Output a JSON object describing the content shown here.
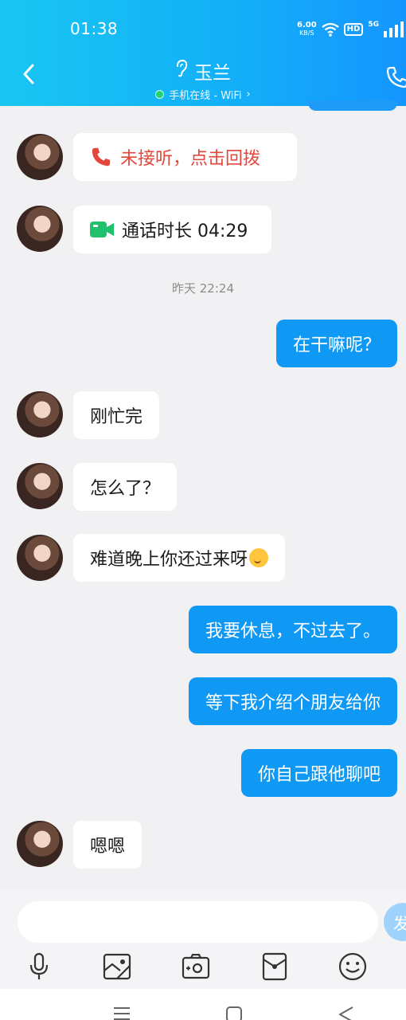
{
  "status_bar": {
    "time": "01:38",
    "speed_value": "6.00",
    "speed_unit": "KB/S",
    "hd": "HD",
    "network": "5G"
  },
  "header": {
    "title": "玉兰",
    "subtitle": "手机在线 - WiFi",
    "subtitle_arrow": "›"
  },
  "messages": {
    "missed_call": "未接听，点击回拨",
    "video_call": "通话时长 04:29",
    "timestamp": "昨天 22:24",
    "m1": "在干嘛呢？",
    "m2": "刚忙完",
    "m3": "怎么了？",
    "m4": "难道晚上你还过来呀",
    "m5": "我要休息，不过去了。",
    "m6": "等下我介绍个朋友给你",
    "m7": "你自己跟他聊吧",
    "m8": "嗯嗯"
  },
  "input": {
    "placeholder": "",
    "send_label": "发"
  },
  "colors": {
    "header_start": "#19c6f2",
    "header_end": "#1596ff",
    "outgoing_bubble": "#0f99f5",
    "missed_call": "#e5463b",
    "video_call": "#1fc26b"
  },
  "icons": [
    "back-arrow-icon",
    "ear-icon",
    "phone-icon",
    "missed-call-icon",
    "video-call-icon",
    "microphone-icon",
    "image-icon",
    "camera-icon",
    "red-packet-icon",
    "emoji-icon",
    "menu-icon",
    "home-icon",
    "back-triangle-icon"
  ]
}
